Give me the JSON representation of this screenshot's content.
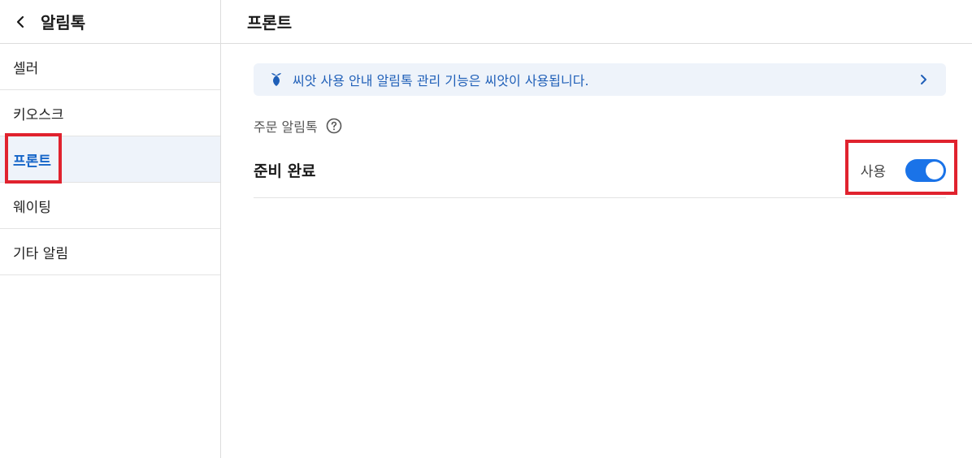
{
  "sidebar": {
    "title": "알림톡",
    "items": [
      {
        "label": "셀러",
        "active": false
      },
      {
        "label": "키오스크",
        "active": false
      },
      {
        "label": "프론트",
        "active": true
      },
      {
        "label": "웨이팅",
        "active": false
      },
      {
        "label": "기타 알림",
        "active": false
      }
    ]
  },
  "main": {
    "title": "프론트",
    "notice": {
      "text": "씨앗 사용 안내 알림톡 관리 기능은 씨앗이 사용됩니다.",
      "icon": "seed-icon"
    },
    "section_label": "주문 알림톡",
    "rows": [
      {
        "label": "준비 완료",
        "toggle_label": "사용",
        "enabled": true
      }
    ]
  },
  "colors": {
    "accent": "#1a73e8",
    "highlight": "#e0222e",
    "notice_bg": "#eef3fa",
    "notice_text": "#1f5fb8"
  }
}
